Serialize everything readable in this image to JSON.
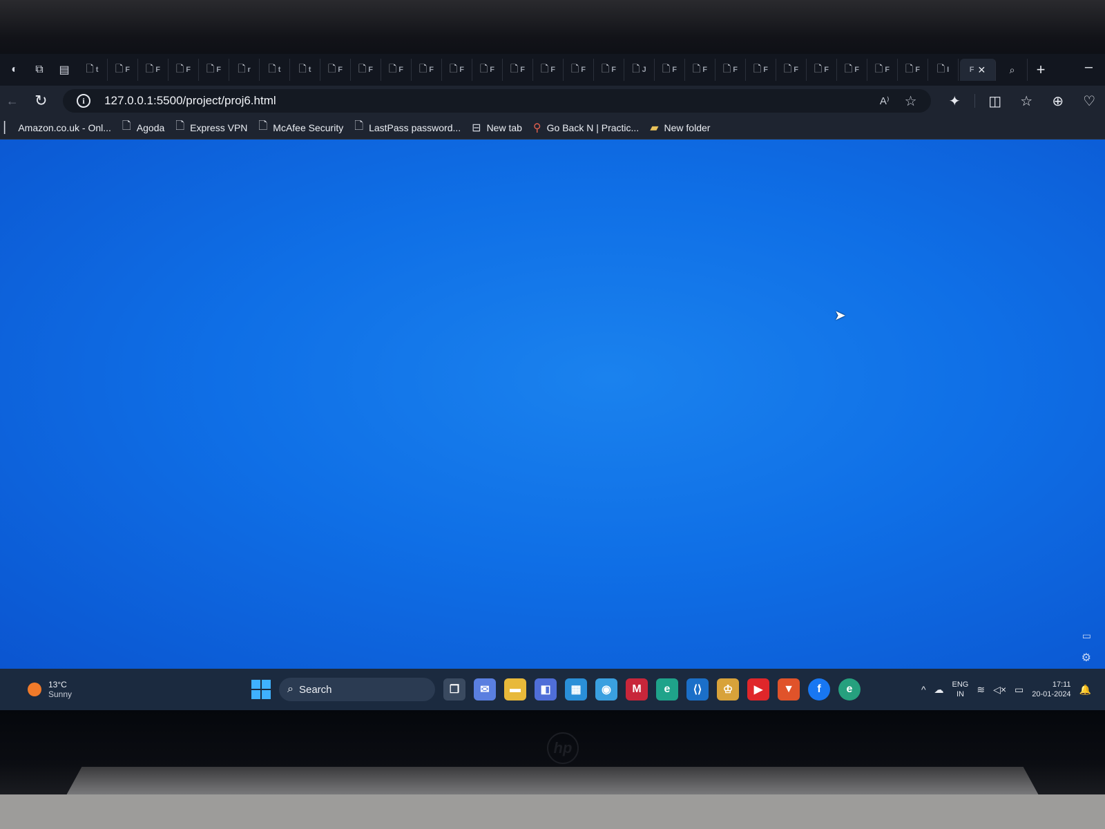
{
  "browser": {
    "address_bar": {
      "url": "127.0.0.1:5500/project/proj6.html"
    },
    "tab_letters": [
      "t",
      "F",
      "F",
      "F",
      "F",
      "r",
      "t",
      "t",
      "F",
      "F",
      "F",
      "F",
      "F",
      "F",
      "F",
      "F",
      "F",
      "F",
      "J",
      "F",
      "F",
      "F",
      "F",
      "F",
      "F",
      "F",
      "F",
      "F",
      "I",
      "F"
    ],
    "bookmarks": [
      {
        "label": "Amazon.co.uk - Onl...",
        "icon": "partial-icon"
      },
      {
        "label": "Agoda",
        "icon": "page-icon"
      },
      {
        "label": "Express VPN",
        "icon": "page-icon"
      },
      {
        "label": "McAfee Security",
        "icon": "page-icon"
      },
      {
        "label": "LastPass password...",
        "icon": "page-icon"
      },
      {
        "label": "New tab",
        "icon": "newtab-icon"
      },
      {
        "label": "Go Back N | Practic...",
        "icon": "pin-icon"
      },
      {
        "label": "New folder",
        "icon": "folder-icon"
      }
    ]
  },
  "page": {
    "background_color": "#0f6fe6"
  },
  "taskbar": {
    "weather": {
      "temp": "13°C",
      "condition": "Sunny"
    },
    "search_label": "Search",
    "tray": {
      "lang": "ENG",
      "region": "IN",
      "time": "17:11",
      "date": "20-01-2024"
    }
  }
}
